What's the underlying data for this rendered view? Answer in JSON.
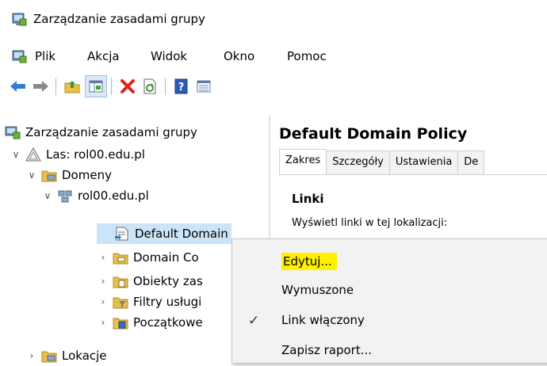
{
  "window": {
    "title": "Zarządzanie zasadami grupy"
  },
  "menu": [
    "Plik",
    "Akcja",
    "Widok",
    "Okno",
    "Pomoc"
  ],
  "toolbar": {
    "icons": [
      "back-arrow-icon",
      "forward-arrow-icon",
      "up-folder-icon",
      "show-hide-console-tree-icon",
      "delete-icon",
      "refresh-icon",
      "help-icon",
      "properties-icon"
    ]
  },
  "tree": {
    "root": "Zarządzanie zasadami grupy",
    "forest": "Las: rol00.edu.pl",
    "domains": "Domeny",
    "domain": "rol00.edu.pl",
    "children": [
      "Default Domain",
      "Domain Co",
      "Obiekty zas",
      "Filtry usługi",
      "Początkowe"
    ],
    "sites": "Lokacje"
  },
  "right_panel": {
    "title": "Default Domain Policy",
    "tabs": [
      "Zakres",
      "Szczegóły",
      "Ustawienia",
      "De"
    ],
    "links_heading": "Linki",
    "links_desc": "Wyświetl linki w tej lokalizacji:"
  },
  "context_menu": {
    "items": [
      {
        "label": "Edytuj...",
        "checked": false
      },
      {
        "label": "Wymuszone",
        "checked": false
      },
      {
        "label": "Link włączony",
        "checked": true
      },
      {
        "label": "Zapisz raport...",
        "checked": false
      }
    ],
    "check_glyph": "✓",
    "highlight_color": "#fff000"
  },
  "colors": {
    "selection": "#cce4f7",
    "accent": "#1e6fc8"
  }
}
